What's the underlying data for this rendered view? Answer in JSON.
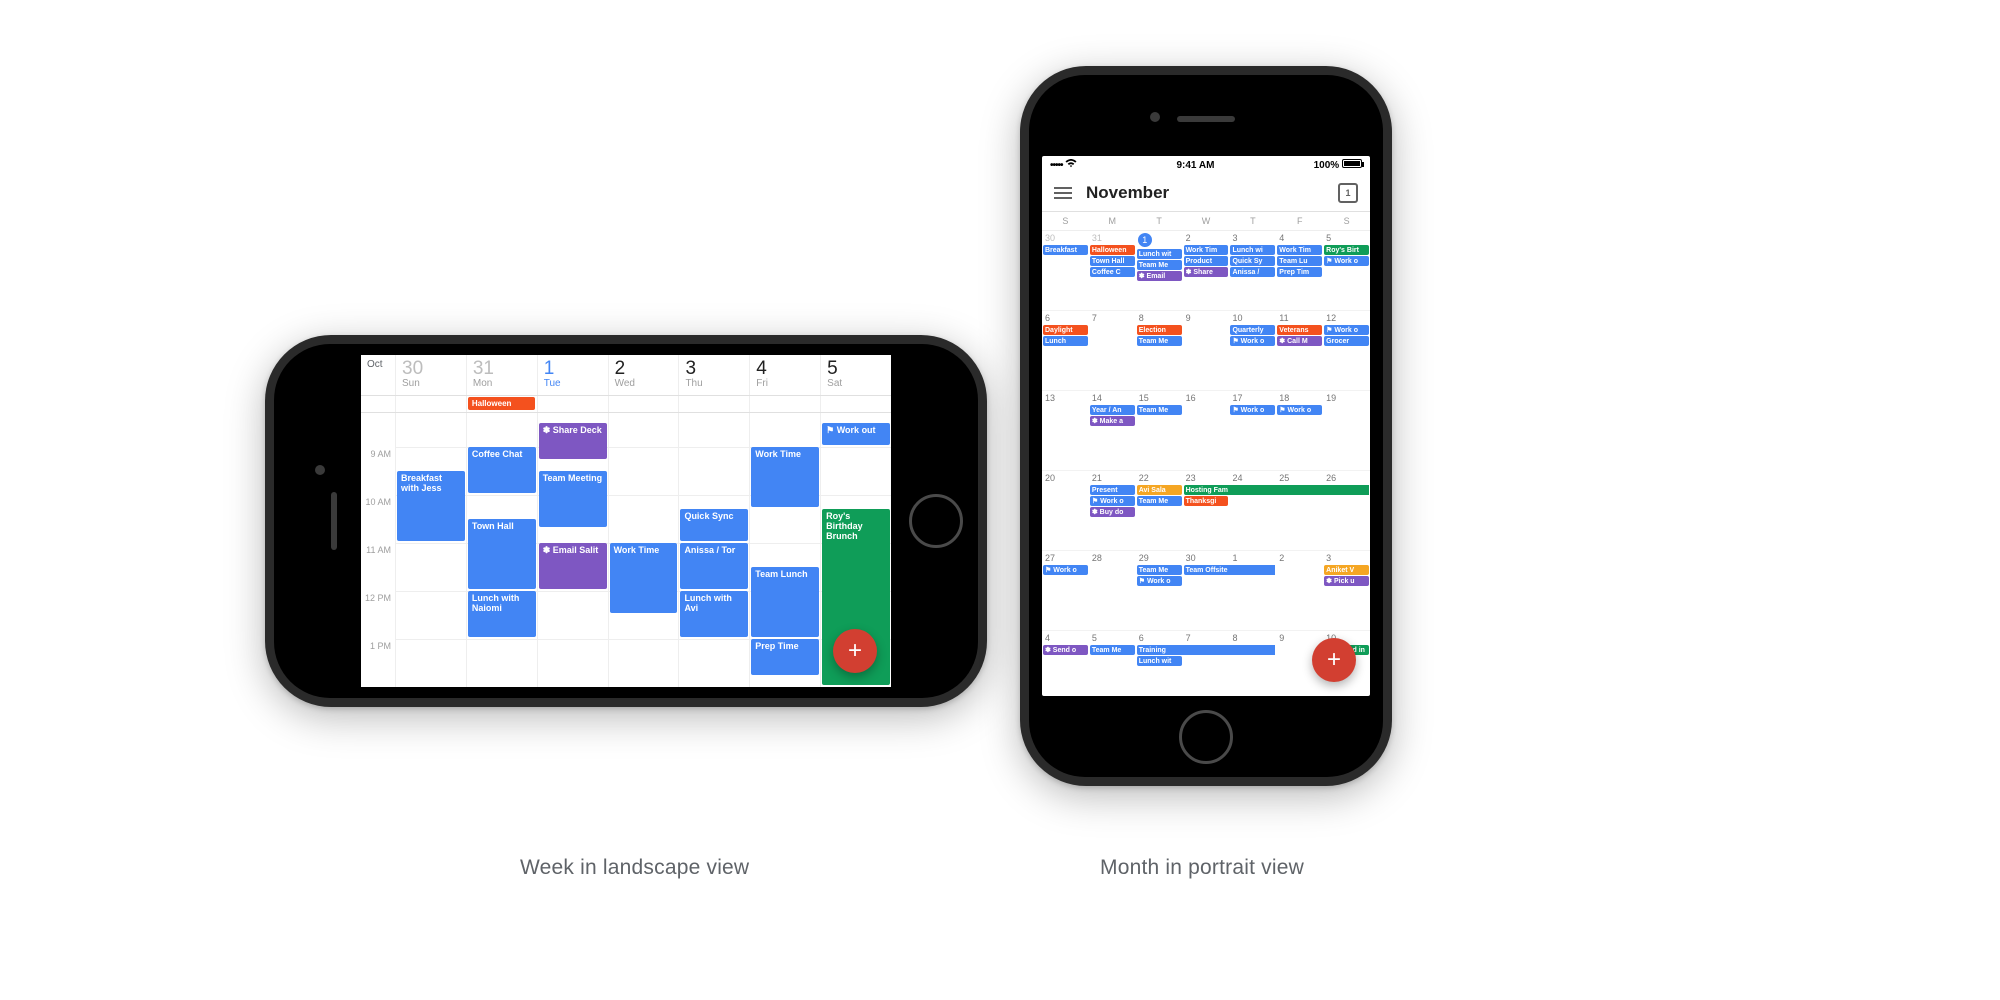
{
  "captions": {
    "landscape": "Week in landscape view",
    "portrait": "Month in portrait view"
  },
  "colors": {
    "blue": "#4285f4",
    "orange": "#f4511e",
    "purple": "#7e57c2",
    "green": "#0f9d58",
    "amber": "#f5a623",
    "fab": "#d23f31"
  },
  "fab_glyph": "+",
  "week_view": {
    "month_label": "Oct",
    "days": [
      {
        "date": "30",
        "dow": "Sun",
        "state": "past"
      },
      {
        "date": "31",
        "dow": "Mon",
        "state": "past"
      },
      {
        "date": "1",
        "dow": "Tue",
        "state": "today"
      },
      {
        "date": "2",
        "dow": "Wed",
        "state": ""
      },
      {
        "date": "3",
        "dow": "Thu",
        "state": ""
      },
      {
        "date": "4",
        "dow": "Fri",
        "state": ""
      },
      {
        "date": "5",
        "dow": "Sat",
        "state": ""
      }
    ],
    "allday": {
      "1": {
        "label": "Halloween",
        "color": "orange"
      }
    },
    "hours": [
      "9 AM",
      "10 AM",
      "11 AM",
      "12 PM",
      "1 PM"
    ],
    "events": [
      {
        "col": 0,
        "start": 9.5,
        "end": 11,
        "label": "Breakfast with Jess",
        "color": "blue"
      },
      {
        "col": 1,
        "start": 9,
        "end": 10,
        "label": "Coffee Chat",
        "color": "blue"
      },
      {
        "col": 1,
        "start": 10.5,
        "end": 12,
        "label": "Town Hall",
        "color": "blue"
      },
      {
        "col": 1,
        "start": 12,
        "end": 13,
        "label": "Lunch with Naiomi",
        "color": "blue"
      },
      {
        "col": 2,
        "start": 8.5,
        "end": 9.3,
        "label": "✽ Share Deck",
        "color": "purple"
      },
      {
        "col": 2,
        "start": 9.5,
        "end": 10.7,
        "label": "Team Meeting",
        "color": "blue"
      },
      {
        "col": 2,
        "start": 11,
        "end": 12,
        "label": "✽ Email Salit",
        "color": "purple"
      },
      {
        "col": 3,
        "start": 11,
        "end": 12.5,
        "label": "Work Time",
        "color": "blue"
      },
      {
        "col": 4,
        "start": 10.3,
        "end": 11,
        "label": "Quick Sync",
        "color": "blue"
      },
      {
        "col": 4,
        "start": 11,
        "end": 12,
        "label": "Anissa / Tor",
        "color": "blue"
      },
      {
        "col": 4,
        "start": 12,
        "end": 13,
        "label": "Lunch with Avi",
        "color": "blue"
      },
      {
        "col": 5,
        "start": 9,
        "end": 10.3,
        "label": "Work Time",
        "color": "blue"
      },
      {
        "col": 5,
        "start": 11.5,
        "end": 13,
        "label": "Team Lunch",
        "color": "blue"
      },
      {
        "col": 5,
        "start": 13,
        "end": 13.8,
        "label": "Prep Time",
        "color": "blue"
      },
      {
        "col": 6,
        "start": 8.5,
        "end": 9,
        "label": "⚑ Work out",
        "color": "blue"
      },
      {
        "col": 6,
        "start": 10.3,
        "end": 14,
        "label": "Roy's Birthday Brunch",
        "color": "green"
      }
    ],
    "grid_start_hour": 8.3
  },
  "month_view": {
    "status": {
      "carrier": "•••••",
      "wifi": "⌃",
      "time": "9:41 AM",
      "battery_pct": "100%"
    },
    "header_title": "November",
    "today_icon_value": "1",
    "dow": [
      "S",
      "M",
      "T",
      "W",
      "T",
      "F",
      "S"
    ],
    "weeks": [
      [
        {
          "d": "30",
          "st": "past",
          "chips": [
            {
              "l": "Breakfast",
              "c": "blue"
            }
          ]
        },
        {
          "d": "31",
          "st": "past",
          "chips": [
            {
              "l": "Halloween",
              "c": "orange"
            },
            {
              "l": "Town Hall",
              "c": "blue"
            },
            {
              "l": "Coffee C",
              "c": "blue"
            }
          ]
        },
        {
          "d": "1",
          "st": "today",
          "chips": [
            {
              "l": "Lunch wit",
              "c": "blue"
            },
            {
              "l": "Team Me",
              "c": "blue"
            },
            {
              "l": "✽ Email",
              "c": "purple"
            }
          ]
        },
        {
          "d": "2",
          "chips": [
            {
              "l": "Work Tim",
              "c": "blue"
            },
            {
              "l": "Product",
              "c": "blue"
            },
            {
              "l": "✽ Share",
              "c": "purple"
            }
          ]
        },
        {
          "d": "3",
          "chips": [
            {
              "l": "Lunch wi",
              "c": "blue"
            },
            {
              "l": "Quick Sy",
              "c": "blue"
            },
            {
              "l": "Anissa /",
              "c": "blue"
            }
          ]
        },
        {
          "d": "4",
          "chips": [
            {
              "l": "Work Tim",
              "c": "blue"
            },
            {
              "l": "Team Lu",
              "c": "blue"
            },
            {
              "l": "Prep Tim",
              "c": "blue"
            }
          ]
        },
        {
          "d": "5",
          "chips": [
            {
              "l": "Roy's Birt",
              "c": "green"
            },
            {
              "l": "⚑ Work o",
              "c": "blue"
            }
          ]
        }
      ],
      [
        {
          "d": "6",
          "chips": [
            {
              "l": "Daylight",
              "c": "orange"
            },
            {
              "l": "Lunch",
              "c": "blue"
            }
          ]
        },
        {
          "d": "7",
          "chips": []
        },
        {
          "d": "8",
          "chips": [
            {
              "l": "Election",
              "c": "orange"
            },
            {
              "l": "Team Me",
              "c": "blue"
            }
          ]
        },
        {
          "d": "9",
          "chips": []
        },
        {
          "d": "10",
          "chips": [
            {
              "l": "Quarterly",
              "c": "blue"
            },
            {
              "l": "⚑ Work o",
              "c": "blue"
            }
          ]
        },
        {
          "d": "11",
          "chips": [
            {
              "l": "Veterans",
              "c": "orange"
            },
            {
              "l": "✽ Call M",
              "c": "purple"
            }
          ]
        },
        {
          "d": "12",
          "chips": [
            {
              "l": "⚑ Work o",
              "c": "blue"
            },
            {
              "l": "Grocer",
              "c": "blue"
            }
          ]
        }
      ],
      [
        {
          "d": "13",
          "chips": []
        },
        {
          "d": "14",
          "chips": [
            {
              "l": "Year / An",
              "c": "blue"
            },
            {
              "l": "✽ Make a",
              "c": "purple"
            }
          ]
        },
        {
          "d": "15",
          "chips": [
            {
              "l": "Team Me",
              "c": "blue"
            }
          ]
        },
        {
          "d": "16",
          "chips": []
        },
        {
          "d": "17",
          "chips": [
            {
              "l": "⚑ Work o",
              "c": "blue"
            }
          ]
        },
        {
          "d": "18",
          "chips": [
            {
              "l": "⚑ Work o",
              "c": "blue"
            }
          ]
        },
        {
          "d": "19",
          "chips": []
        }
      ],
      [
        {
          "d": "20",
          "chips": []
        },
        {
          "d": "21",
          "chips": [
            {
              "l": "Present",
              "c": "blue"
            },
            {
              "l": "⚑ Work o",
              "c": "blue"
            },
            {
              "l": "✽ Buy do",
              "c": "purple"
            }
          ]
        },
        {
          "d": "22",
          "chips": [
            {
              "l": "Avi Sala",
              "c": "amber"
            },
            {
              "l": "Team Me",
              "c": "blue"
            }
          ]
        },
        {
          "d": "23",
          "chips": [
            {
              "l": "Hosting Family for Thanksgiving",
              "c": "green",
              "span": 4
            },
            {
              "l": "Thanksgi",
              "c": "orange"
            }
          ]
        },
        {
          "d": "24",
          "chips": [
            {
              "l": "",
              "c": "green",
              "cont": true
            }
          ]
        },
        {
          "d": "25",
          "chips": [
            {
              "l": "",
              "c": "green",
              "cont": true
            }
          ]
        },
        {
          "d": "26",
          "chips": [
            {
              "l": "",
              "c": "green",
              "cont": true
            }
          ]
        }
      ],
      [
        {
          "d": "27",
          "chips": [
            {
              "l": "⚑ Work o",
              "c": "blue"
            }
          ]
        },
        {
          "d": "28",
          "chips": []
        },
        {
          "d": "29",
          "chips": [
            {
              "l": "Team Me",
              "c": "blue"
            },
            {
              "l": "⚑ Work o",
              "c": "blue"
            }
          ]
        },
        {
          "d": "30",
          "chips": [
            {
              "l": "Team Offsite",
              "c": "blue",
              "span": 2
            }
          ]
        },
        {
          "d": "1",
          "st": "next",
          "chips": [
            {
              "l": "",
              "c": "blue",
              "cont": true
            }
          ]
        },
        {
          "d": "2",
          "st": "next",
          "chips": []
        },
        {
          "d": "3",
          "st": "next",
          "chips": [
            {
              "l": "Aniket V",
              "c": "amber"
            },
            {
              "l": "✽ Pick u",
              "c": "purple"
            }
          ]
        }
      ],
      [
        {
          "d": "4",
          "st": "next",
          "chips": [
            {
              "l": "✽ Send o",
              "c": "purple"
            }
          ]
        },
        {
          "d": "5",
          "st": "next",
          "chips": [
            {
              "l": "Team Me",
              "c": "blue"
            }
          ]
        },
        {
          "d": "6",
          "st": "next",
          "chips": [
            {
              "l": "Training",
              "c": "blue",
              "span": 3
            },
            {
              "l": "Lunch wit",
              "c": "blue"
            }
          ]
        },
        {
          "d": "7",
          "st": "next",
          "chips": [
            {
              "l": "",
              "c": "blue",
              "cont": true
            }
          ]
        },
        {
          "d": "8",
          "st": "next",
          "chips": [
            {
              "l": "",
              "c": "blue",
              "cont": true
            }
          ]
        },
        {
          "d": "9",
          "st": "next",
          "chips": []
        },
        {
          "d": "10",
          "st": "next",
          "chips": [
            {
              "l": "Weekend in",
              "c": "green"
            }
          ]
        }
      ]
    ]
  }
}
